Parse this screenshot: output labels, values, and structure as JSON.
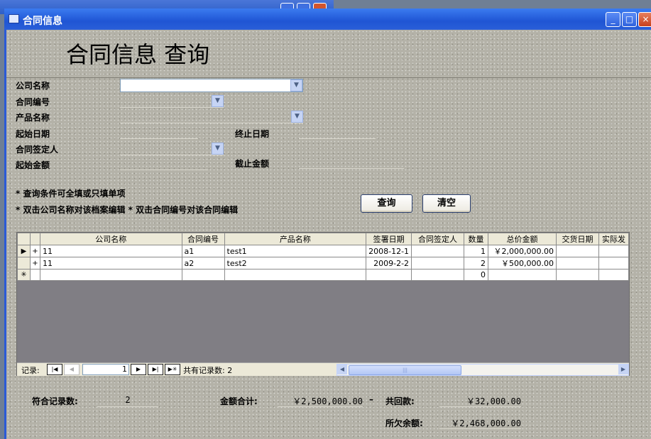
{
  "window": {
    "title": "合同信息"
  },
  "page": {
    "title": "合同信息 查询"
  },
  "form": {
    "company_name_label": "公司名称",
    "contract_no_label": "合同编号",
    "product_name_label": "产品名称",
    "start_date_label": "起始日期",
    "end_date_label": "终止日期",
    "signer_label": "合同签定人",
    "start_amount_label": "起始金额",
    "end_amount_label": "截止金额"
  },
  "notes": {
    "line1": "* 查询条件可全填或只填单项",
    "line2": "* 双击公司名称对该档案编辑 * 双击合同编号对该合同编辑"
  },
  "buttons": {
    "query": "查询",
    "clear": "清空"
  },
  "table": {
    "columns": [
      "公司名称",
      "合同编号",
      "产品名称",
      "签署日期",
      "合同签定人",
      "数量",
      "总价金额",
      "交货日期",
      "实际发"
    ],
    "rows": [
      {
        "selector": "▶",
        "expand": "+",
        "company": "11",
        "contract_no": "a1",
        "product": "test1",
        "sign_date": "2008-12-1",
        "signer": "",
        "qty": "1",
        "total": "￥2,000,000.00",
        "delivery": "",
        "actual": ""
      },
      {
        "selector": "",
        "expand": "+",
        "company": "11",
        "contract_no": "a2",
        "product": "test2",
        "sign_date": "2009-2-2",
        "signer": "",
        "qty": "2",
        "total": "￥500,000.00",
        "delivery": "",
        "actual": ""
      },
      {
        "selector": "✳",
        "expand": "",
        "company": "",
        "contract_no": "",
        "product": "",
        "sign_date": "",
        "signer": "",
        "qty": "0",
        "total": "",
        "delivery": "",
        "actual": ""
      }
    ]
  },
  "navigator": {
    "record_label": "记录:",
    "current": "1",
    "total_label": "共有记录数: 2",
    "first_icon": "first-record-icon",
    "prev_icon": "previous-record-icon",
    "next_icon": "next-record-icon",
    "last_icon": "last-record-icon",
    "new_icon": "new-record-icon"
  },
  "summary": {
    "match_count_label": "符合记录数:",
    "match_count": "2",
    "amount_total_label": "金额合计:",
    "amount_total": "￥2,500,000.00",
    "minus_sign": "–",
    "received_label": "共回款:",
    "received": "￥32,000.00",
    "balance_label": "所欠余额:",
    "balance": "￥2,468,000.00"
  }
}
